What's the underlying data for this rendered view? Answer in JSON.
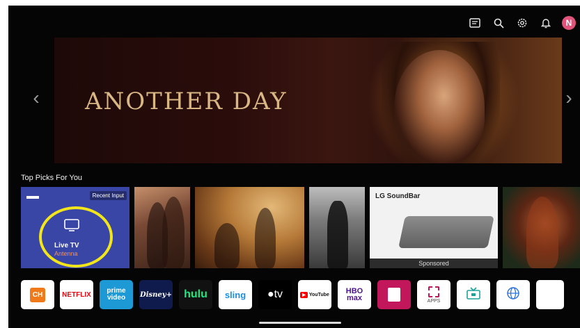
{
  "topbar": {
    "icons": [
      "guide-icon",
      "search-icon",
      "settings-icon",
      "notification-icon"
    ],
    "avatar_initial": "N"
  },
  "hero": {
    "title": "ANOTHER DAY",
    "prev_arrow": "‹",
    "next_arrow": "›"
  },
  "section": {
    "title": "Top Picks For You"
  },
  "cards": {
    "live_tv": {
      "badge": "Recent Input",
      "title": "Live TV",
      "subtitle": "Antenna"
    },
    "soundbar": {
      "brand": "LG SoundBar",
      "sponsored": "Sponsored"
    }
  },
  "apps": [
    {
      "name": "ch",
      "label": "CH"
    },
    {
      "name": "netflix",
      "label": "NETFLIX"
    },
    {
      "name": "prime-video",
      "label": "prime video"
    },
    {
      "name": "disney-plus",
      "label": "Disney+"
    },
    {
      "name": "hulu",
      "label": "hulu"
    },
    {
      "name": "sling",
      "label": "sling"
    },
    {
      "name": "apple-tv",
      "label": "tv"
    },
    {
      "name": "youtube",
      "label": "YouTube"
    },
    {
      "name": "hbo-max",
      "label": "HBO max"
    },
    {
      "name": "lg-shop",
      "label": ""
    },
    {
      "name": "apps",
      "label": "APPS"
    },
    {
      "name": "tv-input",
      "label": ""
    },
    {
      "name": "web-browser",
      "label": ""
    }
  ],
  "colors": {
    "accent_circle": "#f2e61a",
    "live_tv_card": "#3a46a6",
    "avatar": "#e0537a",
    "netflix_red": "#e50914",
    "hulu_green": "#1ce783"
  }
}
